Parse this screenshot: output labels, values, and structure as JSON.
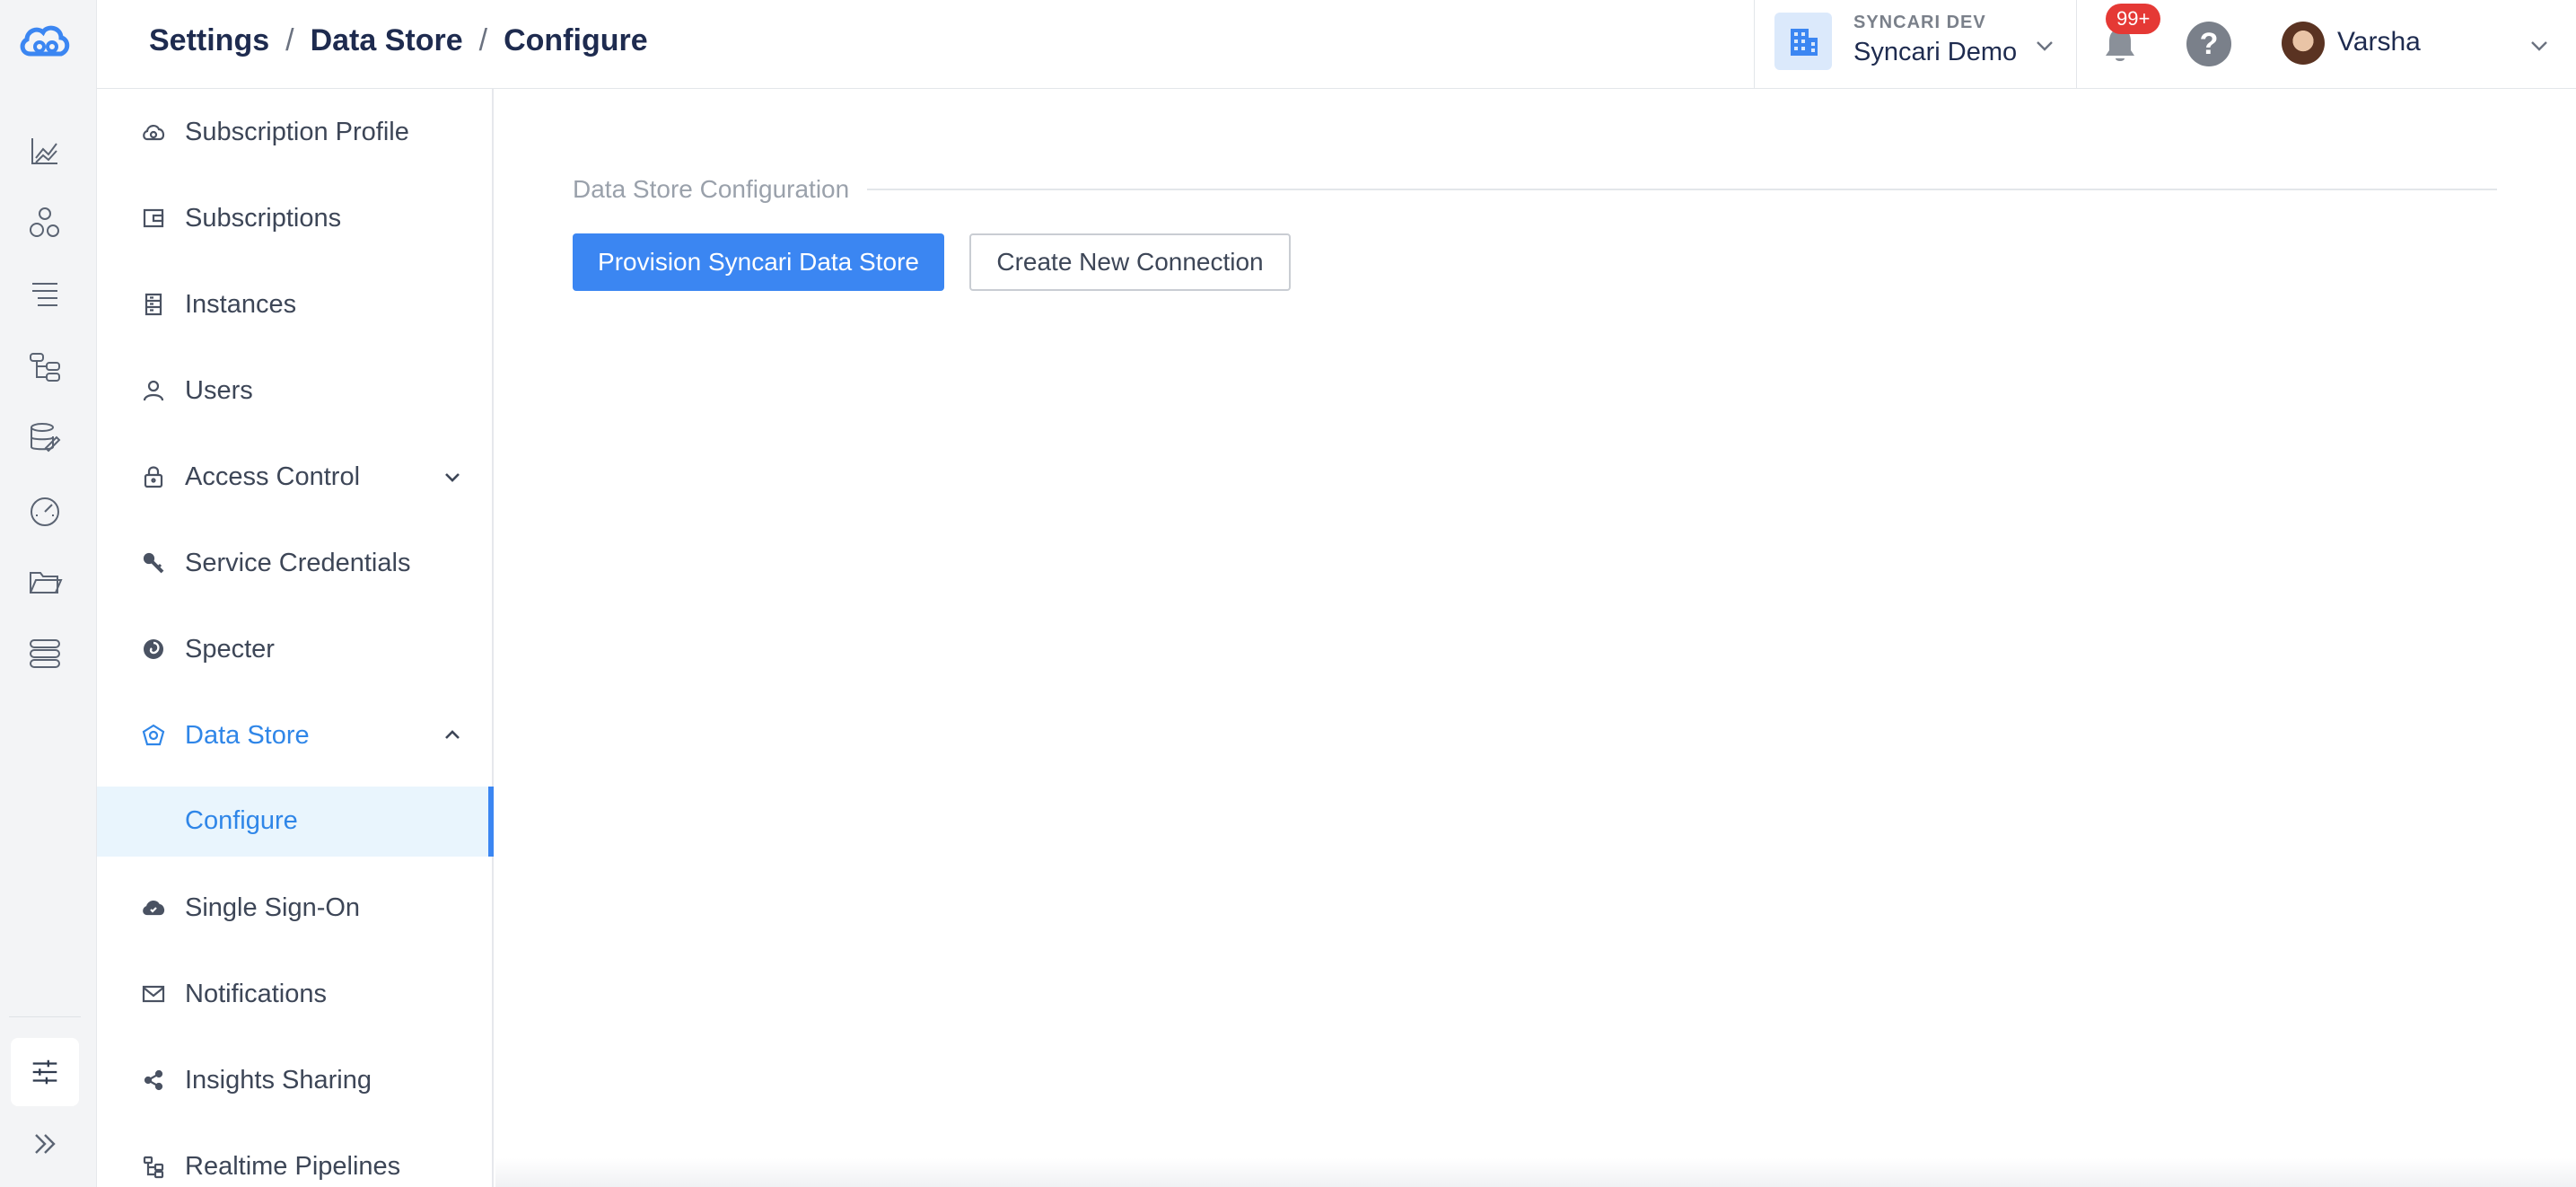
{
  "header": {
    "breadcrumb": [
      "Settings",
      "Data Store",
      "Configure"
    ],
    "breadcrumb_separator": "/",
    "org": {
      "label": "SYNCARI DEV",
      "name": "Syncari Demo"
    },
    "notifications_badge": "99+",
    "help_glyph": "?",
    "user_name": "Varsha"
  },
  "rail": {
    "icons": [
      "analytics-icon",
      "bubbles-icon",
      "list-icon",
      "flow-icon",
      "database-edit-icon",
      "gauge-icon",
      "folder-icon",
      "stack-icon"
    ],
    "active": "settings-sliders-icon"
  },
  "sidebar": {
    "items": [
      {
        "label": "Subscription Profile",
        "icon": "cloud-sync-icon"
      },
      {
        "label": "Subscriptions",
        "icon": "wallet-icon"
      },
      {
        "label": "Instances",
        "icon": "server-icon"
      },
      {
        "label": "Users",
        "icon": "user-icon"
      },
      {
        "label": "Access Control",
        "icon": "lock-icon"
      },
      {
        "label": "Service Credentials",
        "icon": "key-icon"
      },
      {
        "label": "Specter",
        "icon": "spiral-icon"
      },
      {
        "label": "Data Store",
        "icon": "datastore-icon"
      },
      {
        "label": "Single Sign-On",
        "icon": "cloud-icon"
      },
      {
        "label": "Notifications",
        "icon": "mail-icon"
      },
      {
        "label": "Insights Sharing",
        "icon": "share-icon"
      },
      {
        "label": "Realtime Pipelines",
        "icon": "pipeline-icon"
      }
    ],
    "sub_items": {
      "data_store": [
        {
          "label": "Configure"
        }
      ]
    }
  },
  "main": {
    "section_title": "Data Store Configuration",
    "primary_button": "Provision Syncari Data Store",
    "secondary_button": "Create New Connection"
  },
  "colors": {
    "accent": "#3b86f2",
    "active_text": "#2f86e8",
    "active_bg": "#e9f5fd",
    "badge": "#e53935"
  }
}
